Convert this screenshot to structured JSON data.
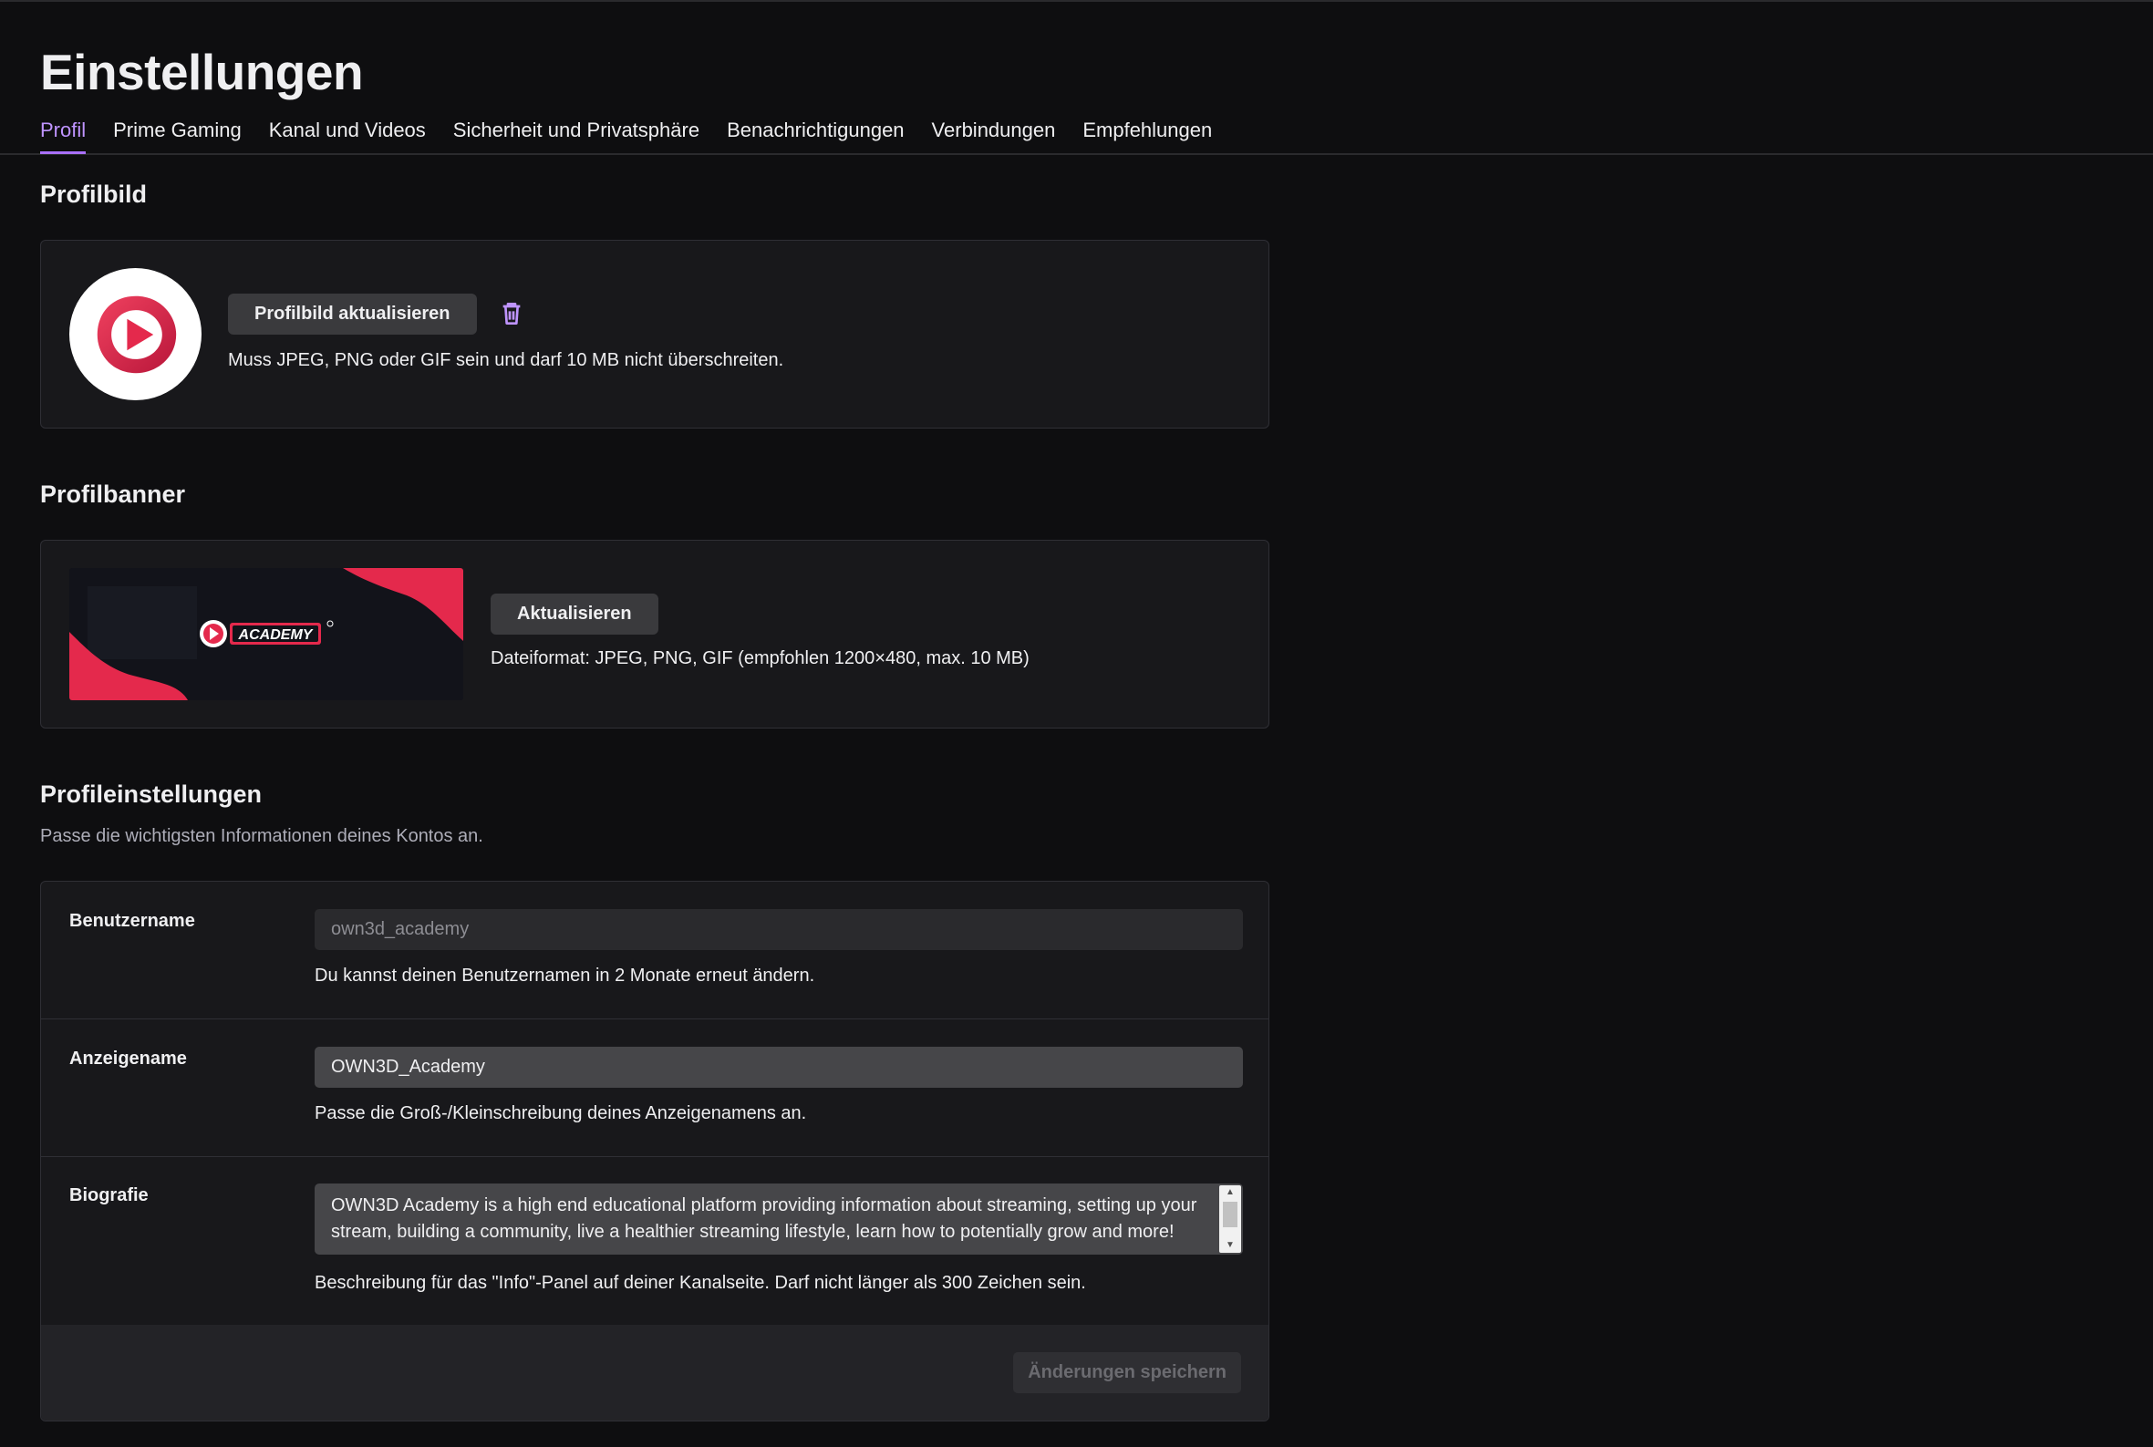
{
  "page": {
    "title": "Einstellungen",
    "tabs": [
      {
        "label": "Profil",
        "active": true
      },
      {
        "label": "Prime Gaming",
        "active": false
      },
      {
        "label": "Kanal und Videos",
        "active": false
      },
      {
        "label": "Sicherheit und Privatsphäre",
        "active": false
      },
      {
        "label": "Benachrichtigungen",
        "active": false
      },
      {
        "label": "Verbindungen",
        "active": false
      },
      {
        "label": "Empfehlungen",
        "active": false
      }
    ]
  },
  "profile_picture": {
    "section_title": "Profilbild",
    "update_button": "Profilbild aktualisieren",
    "hint": "Muss JPEG, PNG oder GIF sein und darf 10 MB nicht überschreiten."
  },
  "profile_banner": {
    "section_title": "Profilbanner",
    "update_button": "Aktualisieren",
    "hint": "Dateiformat: JPEG, PNG, GIF (empfohlen 1200×480, max. 10 MB)",
    "banner_text": "ACADEMY"
  },
  "profile_settings": {
    "section_title": "Profileinstellungen",
    "subtitle": "Passe die wichtigsten Informationen deines Kontos an.",
    "username": {
      "label": "Benutzername",
      "value": "own3d_academy",
      "hint": "Du kannst deinen Benutzernamen in 2 Monate erneut ändern."
    },
    "display_name": {
      "label": "Anzeigename",
      "value": "OWN3D_Academy",
      "hint": "Passe die Groß-/Kleinschreibung deines Anzeigenamens an."
    },
    "bio": {
      "label": "Biografie",
      "value": "OWN3D Academy is a high end educational platform providing information about streaming, setting up your stream, building a community, live a healthier streaming lifestyle, learn how to potentially grow and more!",
      "hint": "Beschreibung für das \"Info\"-Panel auf deiner Kanalseite. Darf nicht länger als 300 Zeichen sein."
    },
    "save_button": "Änderungen speichern"
  },
  "colors": {
    "background": "#0e0e10",
    "accent": "#a970ff",
    "card": "#18181b",
    "brand_red": "#e4294c"
  },
  "icons": [
    "trash-icon",
    "own3d-logo",
    "scroll-up-icon",
    "scroll-down-icon"
  ]
}
